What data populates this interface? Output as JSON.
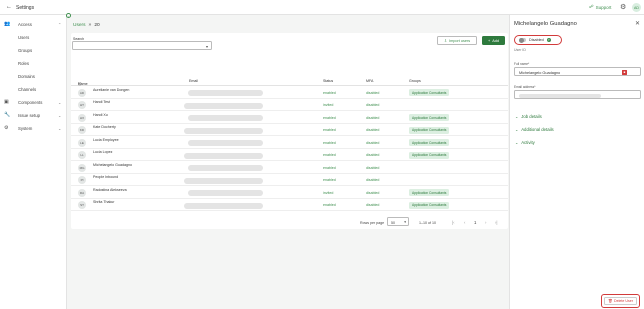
{
  "topbar": {
    "title": "Settings",
    "support_label": "Support",
    "avatar_initials": "AD"
  },
  "sidebar": {
    "items": [
      {
        "label": "Access",
        "icon": "people-icon",
        "expanded": true
      },
      {
        "label": "Components",
        "icon": "components-icon",
        "expanded": false
      },
      {
        "label": "Issue setup",
        "icon": "wrench-icon",
        "expanded": false
      },
      {
        "label": "System",
        "icon": "gear-icon",
        "expanded": false
      }
    ],
    "access_sub": [
      "Users",
      "Groups",
      "Roles",
      "Domains",
      "Channels"
    ]
  },
  "breadcrumb": {
    "link": "Users",
    "separator": "»",
    "count": "20"
  },
  "toolbar": {
    "search_label": "Search",
    "search_value": "",
    "import_label": "Import users",
    "add_label": "Add"
  },
  "table": {
    "headers": {
      "name": "Name",
      "email": "Email",
      "status": "Status",
      "mfa": "MFA",
      "groups": "Groups"
    },
    "rows": [
      {
        "initials": "AD",
        "name": "Aurelianie van Dongen",
        "status": "enabled",
        "mfa": "disabled",
        "group": "Application Consultants"
      },
      {
        "initials": "HT",
        "name": "Handi Test",
        "status": "invited",
        "mfa": "disabled",
        "group": ""
      },
      {
        "initials": "HX",
        "name": "Handi Xu",
        "status": "enabled",
        "mfa": "disabled",
        "group": "Application Consultants"
      },
      {
        "initials": "KD",
        "name": "Kate Docherty",
        "status": "enabled",
        "mfa": "disabled",
        "group": "Application Consultants"
      },
      {
        "initials": "LE",
        "name": "Lucia Employee",
        "status": "enabled",
        "mfa": "disabled",
        "group": "Application Consultants"
      },
      {
        "initials": "LL",
        "name": "Lucia Lopez",
        "status": "enabled",
        "mfa": "disabled",
        "group": "Application Consultants"
      },
      {
        "initials": "MG",
        "name": "Michelangelo Guadagno",
        "status": "enabled",
        "mfa": "disabled",
        "group": ""
      },
      {
        "initials": "PI",
        "name": "People Inbound",
        "status": "enabled",
        "mfa": "disabled",
        "group": ""
      },
      {
        "initials": "RA",
        "name": "Radostina Alekseeva",
        "status": "invited",
        "mfa": "disabled",
        "group": "Application Consultants"
      },
      {
        "initials": "ST",
        "name": "Shrita Thakur",
        "status": "enabled",
        "mfa": "disabled",
        "group": "Application Consultants"
      }
    ]
  },
  "pagination": {
    "rows_per_page_label": "Rows per page",
    "rows_per_page_value": "50",
    "range": "1–10 of 10",
    "first": "|‹",
    "prev": "‹",
    "page": "1",
    "next": "›",
    "last": "›|"
  },
  "panel": {
    "title": "Michelangelo Guadagno",
    "status_label": "Disabled",
    "user_id_label": "User ID",
    "full_name_label": "Full name*",
    "full_name_value": "Michelangelo Guadagno",
    "email_label": "Email address*",
    "sections": [
      "Job details",
      "Additional details",
      "Activity"
    ],
    "delete_label": "Delete User"
  },
  "colors": {
    "accent": "#2e7a3d",
    "highlight_outline": "#d23b3b"
  }
}
